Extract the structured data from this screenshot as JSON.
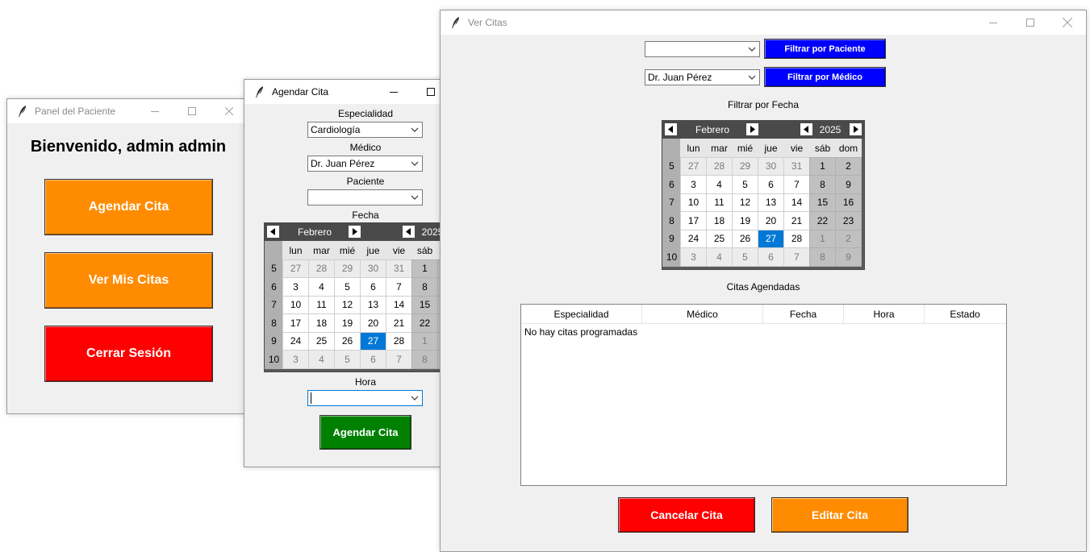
{
  "panel": {
    "title": "Panel del Paciente",
    "welcome": "Bienvenido, admin admin",
    "btn_agendar": "Agendar Cita",
    "btn_ver": "Ver Mis Citas",
    "btn_cerrar": "Cerrar Sesión"
  },
  "agendar": {
    "title": "Agendar Cita",
    "especialidad_label": "Especialidad",
    "especialidad_value": "Cardiología",
    "medico_label": "Médico",
    "medico_value": "Dr. Juan Pérez",
    "paciente_label": "Paciente",
    "paciente_value": "",
    "fecha_label": "Fecha",
    "hora_label": "Hora",
    "hora_value": "",
    "submit": "Agendar Cita"
  },
  "ver": {
    "title": "Ver Citas",
    "paciente_filter_value": "",
    "btn_filtrar_paciente": "Filtrar por Paciente",
    "medico_filter_value": "Dr. Juan Pérez",
    "btn_filtrar_medico": "Filtrar por Médico",
    "fecha_label": "Filtrar por Fecha",
    "citas_label": "Citas Agendadas",
    "columns": [
      "Especialidad",
      "Médico",
      "Fecha",
      "Hora",
      "Estado"
    ],
    "empty_text": "No hay citas programadas",
    "btn_cancelar": "Cancelar Cita",
    "btn_editar": "Editar Cita"
  },
  "calendar": {
    "month": "Febrero",
    "year": "2025",
    "weekdays": [
      "lun",
      "mar",
      "mié",
      "jue",
      "vie",
      "sáb",
      "dom"
    ],
    "weeks": [
      {
        "num": "5",
        "days": [
          [
            "27",
            "o"
          ],
          [
            "28",
            "o"
          ],
          [
            "29",
            "o"
          ],
          [
            "30",
            "o"
          ],
          [
            "31",
            "o"
          ],
          [
            "1",
            "n"
          ],
          [
            "2",
            "n"
          ]
        ]
      },
      {
        "num": "6",
        "days": [
          [
            "3",
            "n"
          ],
          [
            "4",
            "n"
          ],
          [
            "5",
            "n"
          ],
          [
            "6",
            "n"
          ],
          [
            "7",
            "n"
          ],
          [
            "8",
            "n"
          ],
          [
            "9",
            "n"
          ]
        ]
      },
      {
        "num": "7",
        "days": [
          [
            "10",
            "n"
          ],
          [
            "11",
            "n"
          ],
          [
            "12",
            "n"
          ],
          [
            "13",
            "n"
          ],
          [
            "14",
            "n"
          ],
          [
            "15",
            "n"
          ],
          [
            "16",
            "n"
          ]
        ]
      },
      {
        "num": "8",
        "days": [
          [
            "17",
            "n"
          ],
          [
            "18",
            "n"
          ],
          [
            "19",
            "n"
          ],
          [
            "20",
            "n"
          ],
          [
            "21",
            "n"
          ],
          [
            "22",
            "n"
          ],
          [
            "23",
            "n"
          ]
        ]
      },
      {
        "num": "9",
        "days": [
          [
            "24",
            "n"
          ],
          [
            "25",
            "n"
          ],
          [
            "26",
            "n"
          ],
          [
            "27",
            "s"
          ],
          [
            "28",
            "n"
          ],
          [
            "1",
            "o"
          ],
          [
            "2",
            "o"
          ]
        ]
      },
      {
        "num": "10",
        "days": [
          [
            "3",
            "o"
          ],
          [
            "4",
            "o"
          ],
          [
            "5",
            "o"
          ],
          [
            "6",
            "o"
          ],
          [
            "7",
            "o"
          ],
          [
            "8",
            "o"
          ],
          [
            "9",
            "o"
          ]
        ]
      }
    ]
  },
  "colors": {
    "orange": "#ff8c00",
    "red": "#ff0000",
    "green": "#008000",
    "blue": "#0000ff",
    "selected_day": "#0078d7"
  },
  "icons": {
    "app": "feather-icon",
    "minimize": "minimize-icon",
    "maximize": "maximize-icon",
    "close": "close-icon",
    "dropdown": "chevron-down-icon",
    "prev": "triangle-left-icon",
    "next": "triangle-right-icon"
  }
}
